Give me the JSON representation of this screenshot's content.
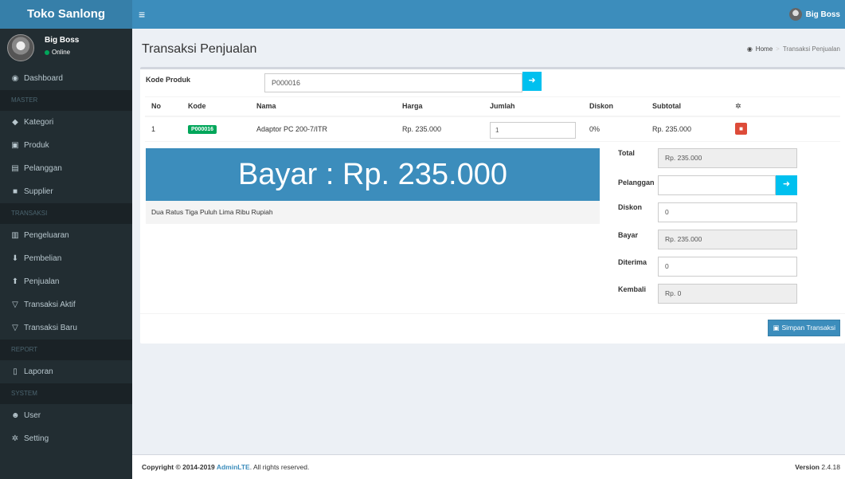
{
  "app": {
    "brand": "Toko Sanlong",
    "user_top": "Big Boss"
  },
  "sidebar": {
    "user_name": "Big Boss",
    "user_status": "Online",
    "items": [
      {
        "type": "item",
        "icon": "dashboard-icon",
        "glyph": "◉",
        "label": "Dashboard"
      },
      {
        "type": "header",
        "label": "MASTER"
      },
      {
        "type": "item",
        "icon": "tag-icon",
        "glyph": "◆",
        "label": "Kategori"
      },
      {
        "type": "item",
        "icon": "cubes-icon",
        "glyph": "▣",
        "label": "Produk"
      },
      {
        "type": "item",
        "icon": "id-card-icon",
        "glyph": "▤",
        "label": "Pelanggan"
      },
      {
        "type": "item",
        "icon": "truck-icon",
        "glyph": "■",
        "label": "Supplier"
      },
      {
        "type": "header",
        "label": "TRANSAKSI"
      },
      {
        "type": "item",
        "icon": "money-icon",
        "glyph": "▥",
        "label": "Pengeluaran"
      },
      {
        "type": "item",
        "icon": "download-icon",
        "glyph": "⬇",
        "label": "Pembelian"
      },
      {
        "type": "item",
        "icon": "upload-icon",
        "glyph": "⬆",
        "label": "Penjualan"
      },
      {
        "type": "item",
        "icon": "cart-icon",
        "glyph": "▽",
        "label": "Transaksi Aktif"
      },
      {
        "type": "item",
        "icon": "cart-icon",
        "glyph": "▽",
        "label": "Transaksi Baru"
      },
      {
        "type": "header",
        "label": "REPORT"
      },
      {
        "type": "item",
        "icon": "file-icon",
        "glyph": "▯",
        "label": "Laporan"
      },
      {
        "type": "header",
        "label": "SYSTEM"
      },
      {
        "type": "item",
        "icon": "users-icon",
        "glyph": "☻",
        "label": "User"
      },
      {
        "type": "item",
        "icon": "cogs-icon",
        "glyph": "✲",
        "label": "Setting"
      }
    ]
  },
  "page": {
    "title": "Transaksi Penjualan",
    "breadcrumb_home": "Home",
    "breadcrumb_active": "Transaksi Penjualan"
  },
  "form": {
    "kode_label": "Kode Produk",
    "kode_value": "P000016"
  },
  "table": {
    "headers": [
      "No",
      "Kode",
      "Nama",
      "Harga",
      "Jumlah",
      "Diskon",
      "Subtotal"
    ],
    "rows": [
      {
        "no": "1",
        "kode": "P000016",
        "nama": "Adaptor PC 200-7/ITR",
        "harga": "Rp. 235.000",
        "jumlah": "1",
        "diskon": "0%",
        "subtotal": "Rp. 235.000"
      }
    ]
  },
  "bayar": {
    "display": "Bayar : Rp. 235.000",
    "terbilang": "Dua Ratus Tiga Puluh Lima Ribu Rupiah"
  },
  "summary": {
    "total_label": "Total",
    "total_value": "Rp. 235.000",
    "pelanggan_label": "Pelanggan",
    "pelanggan_value": "",
    "diskon_label": "Diskon",
    "diskon_value": "0",
    "bayar_label": "Bayar",
    "bayar_value": "Rp. 235.000",
    "diterima_label": "Diterima",
    "diterima_value": "0",
    "kembali_label": "Kembali",
    "kembali_value": "Rp. 0"
  },
  "actions": {
    "simpan": "Simpan Transaksi"
  },
  "footer": {
    "copyright_prefix": "Copyright © 2014-2019 ",
    "copyright_brand": "AdminLTE",
    "copyright_suffix": ". All rights reserved.",
    "version_label": "Version",
    "version_value": "2.4.18"
  },
  "colors": {
    "primary": "#3c8dbc",
    "info": "#00c0ef",
    "success": "#00a65a",
    "danger": "#dd4b39",
    "sidebar": "#222d32"
  }
}
